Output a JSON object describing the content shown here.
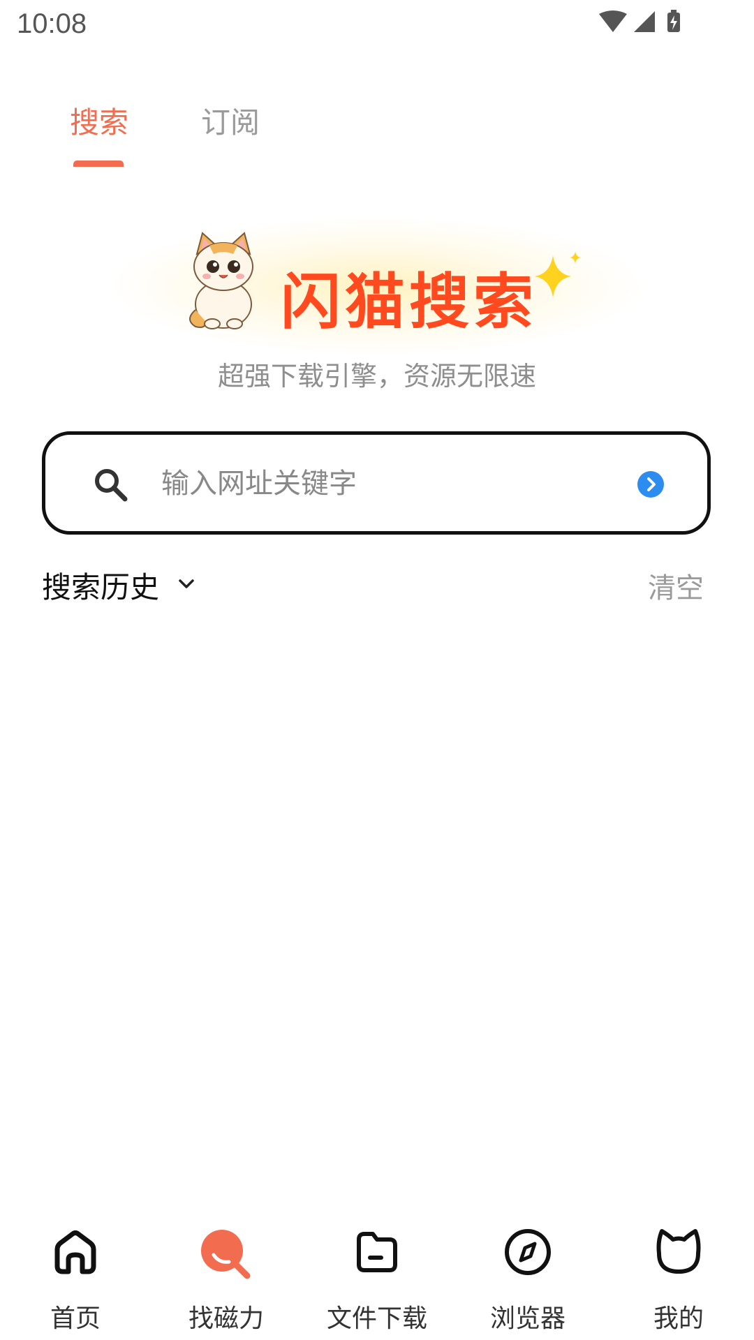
{
  "status_bar": {
    "time": "10:08",
    "icons": [
      "wifi-icon",
      "signal-icon",
      "battery-charging-icon"
    ]
  },
  "tabs": [
    {
      "label": "搜索",
      "active": true
    },
    {
      "label": "订阅",
      "active": false
    }
  ],
  "hero": {
    "title": "闪猫搜索",
    "subtitle": "超强下载引擎，资源无限速",
    "icons": [
      "cat-mascot-icon",
      "sparkle-icon"
    ]
  },
  "search": {
    "placeholder": "输入网址关键字",
    "value": ""
  },
  "history": {
    "title": "搜索历史",
    "clear_label": "清空"
  },
  "bottom_nav": [
    {
      "label": "首页",
      "icon": "home-icon"
    },
    {
      "label": "找磁力",
      "icon": "magnet-search-icon",
      "active": true
    },
    {
      "label": "文件下载",
      "icon": "folder-icon"
    },
    {
      "label": "浏览器",
      "icon": "compass-icon"
    },
    {
      "label": "我的",
      "icon": "cat-profile-icon"
    }
  ],
  "colors": {
    "accent": "#f26d4f",
    "brand_title": "#ff4a1f",
    "go_button": "#2d8cf0",
    "muted": "#9a9a9a"
  }
}
